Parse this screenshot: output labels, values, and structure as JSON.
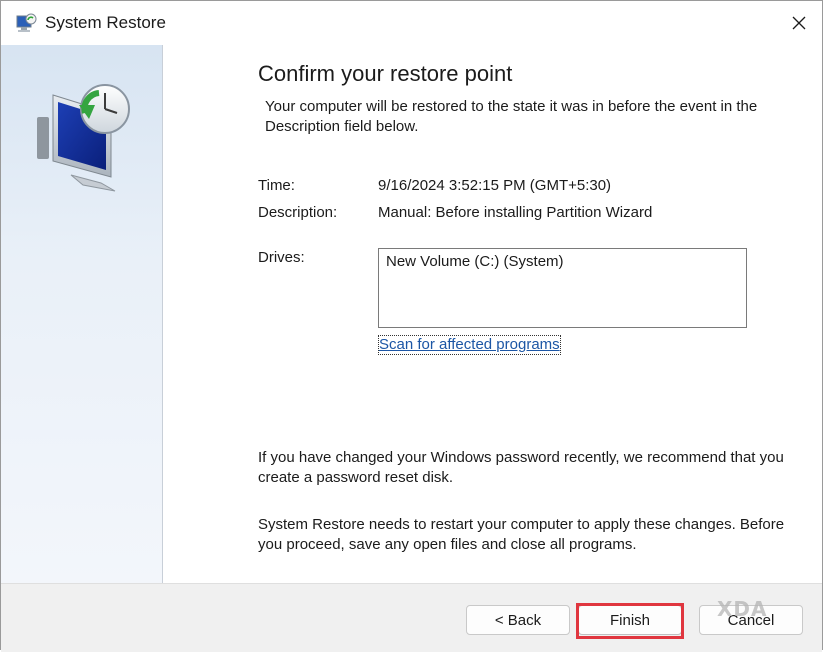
{
  "window": {
    "title": "System Restore",
    "close_glyph": "✕"
  },
  "sidebar": {
    "icon": "system-restore-monitor-clock-icon"
  },
  "content": {
    "heading": "Confirm your restore point",
    "intro": "Your computer will be restored to the state it was in before the event in the Description field below.",
    "time_label": "Time:",
    "time_value": "9/16/2024 3:52:15 PM (GMT+5:30)",
    "description_label": "Description:",
    "description_value": "Manual: Before installing Partition Wizard",
    "drives_label": "Drives:",
    "drives": [
      "New Volume (C:) (System)"
    ],
    "scan_link": "Scan for affected programs",
    "password_note": "If you have changed your Windows password recently, we recommend that you create a password reset disk.",
    "restart_note": "System Restore needs to restart your computer to apply these changes. Before you proceed, save any open files and close all programs."
  },
  "footer": {
    "back_label": "< Back",
    "finish_label": "Finish",
    "cancel_label": "Cancel"
  },
  "watermark": "XDA",
  "colors": {
    "link": "#1c56a5",
    "highlight": "#e0363f",
    "sidebar_top": "#d7e4f2"
  }
}
